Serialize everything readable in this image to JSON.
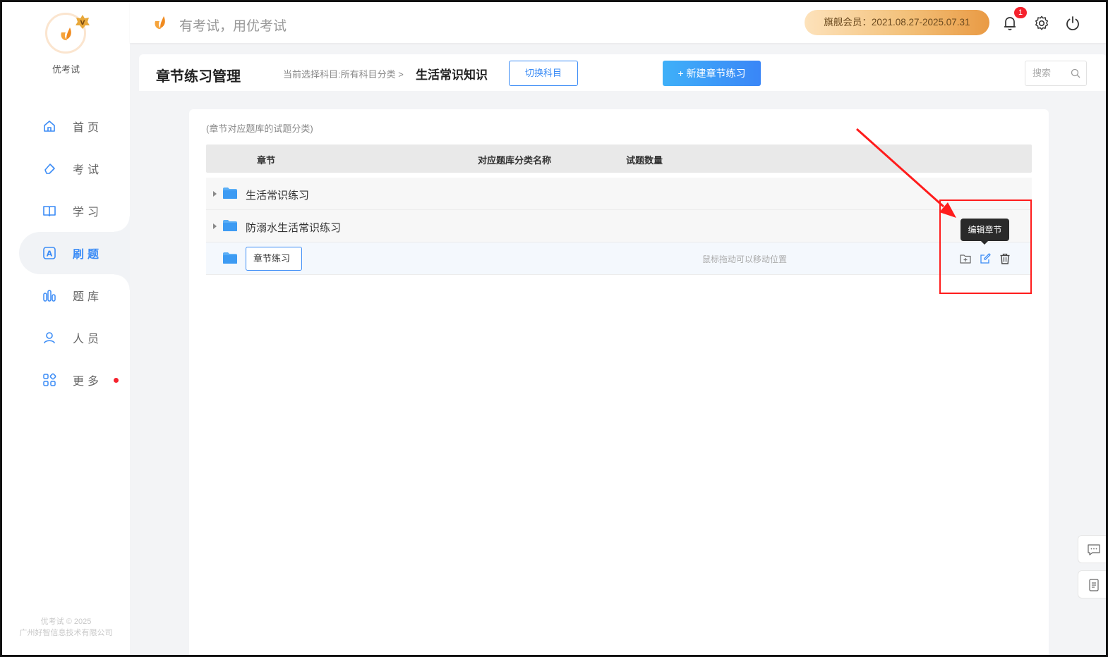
{
  "sidebar": {
    "brand": "优考试",
    "items": [
      {
        "label": "首页",
        "icon": "home-icon"
      },
      {
        "label": "考试",
        "icon": "eraser-icon"
      },
      {
        "label": "学习",
        "icon": "book-icon"
      },
      {
        "label": "刷题",
        "icon": "letter-a-icon",
        "active": true
      },
      {
        "label": "题库",
        "icon": "bar-chart-icon"
      },
      {
        "label": "人员",
        "icon": "user-icon"
      },
      {
        "label": "更多",
        "icon": "apps-icon",
        "dot": true
      }
    ],
    "copyright_line1": "优考试 © 2025",
    "copyright_line2": "广州好智信息技术有限公司"
  },
  "topbar": {
    "slogan": "有考试，用优考试",
    "member": "旗舰会员：2021.08.27-2025.07.31",
    "notification_count": "1"
  },
  "header": {
    "title": "章节练习管理",
    "crumb": "当前选择科目:所有科目分类 >",
    "subject": "生活常识知识",
    "switch_label": "切换科目",
    "new_label": "+ 新建章节练习",
    "search_placeholder": "搜索"
  },
  "table": {
    "hint": "(章节对应题库的试题分类)",
    "columns": {
      "chapter": "章节",
      "category": "对应题库分类名称",
      "count": "试题数量"
    },
    "rows": [
      {
        "name": "生活常识练习"
      },
      {
        "name": "防溺水生活常识练习"
      }
    ],
    "editing_value": "章节练习",
    "drag_tip": "鼠标拖动可以移动位置",
    "tooltip": "编辑章节"
  },
  "colors": {
    "accent": "#3b8cf6",
    "highlight": "#ff1c1c",
    "badge": "#f5222d"
  }
}
